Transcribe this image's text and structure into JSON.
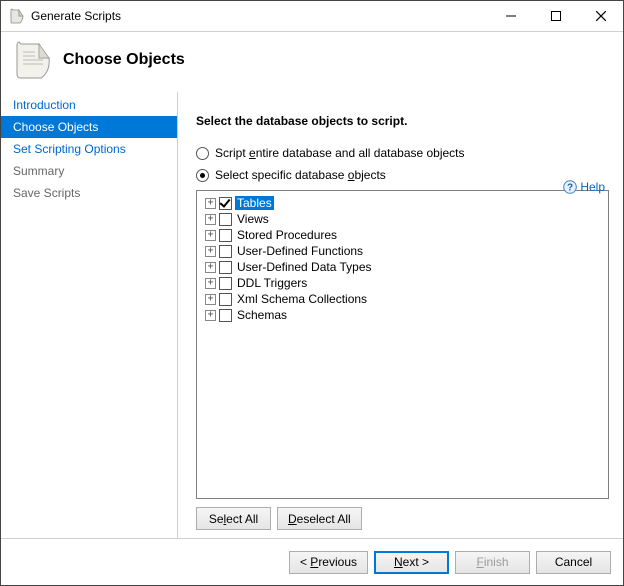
{
  "window": {
    "title": "Generate Scripts"
  },
  "header": {
    "title": "Choose Objects"
  },
  "help": {
    "label": "Help"
  },
  "sidebar": {
    "items": [
      {
        "label": "Introduction",
        "state": "link"
      },
      {
        "label": "Choose Objects",
        "state": "selected"
      },
      {
        "label": "Set Scripting Options",
        "state": "link"
      },
      {
        "label": "Summary",
        "state": "muted"
      },
      {
        "label": "Save Scripts",
        "state": "muted"
      }
    ]
  },
  "main": {
    "instruction": "Select the database objects to script.",
    "radios": {
      "entire_pre": "Script ",
      "entire_u": "e",
      "entire_post": "ntire database and all database objects",
      "specific_pre": "Select specific database ",
      "specific_u": "o",
      "specific_post": "bjects",
      "selected": "specific"
    },
    "tree": [
      {
        "label": "Tables",
        "checked": true,
        "highlighted": true
      },
      {
        "label": "Views",
        "checked": false,
        "highlighted": false
      },
      {
        "label": "Stored Procedures",
        "checked": false,
        "highlighted": false
      },
      {
        "label": "User-Defined Functions",
        "checked": false,
        "highlighted": false
      },
      {
        "label": "User-Defined Data Types",
        "checked": false,
        "highlighted": false
      },
      {
        "label": "DDL Triggers",
        "checked": false,
        "highlighted": false
      },
      {
        "label": "Xml Schema Collections",
        "checked": false,
        "highlighted": false
      },
      {
        "label": "Schemas",
        "checked": false,
        "highlighted": false
      }
    ],
    "select_all_pre": "Se",
    "select_all_u": "l",
    "select_all_post": "ect All",
    "deselect_all_u": "D",
    "deselect_all_post": "eselect All"
  },
  "footer": {
    "prev_pre": "< ",
    "prev_u": "P",
    "prev_post": "revious",
    "next_u": "N",
    "next_post": "ext >",
    "finish_u": "F",
    "finish_post": "inish",
    "cancel": "Cancel",
    "finish_enabled": false
  }
}
